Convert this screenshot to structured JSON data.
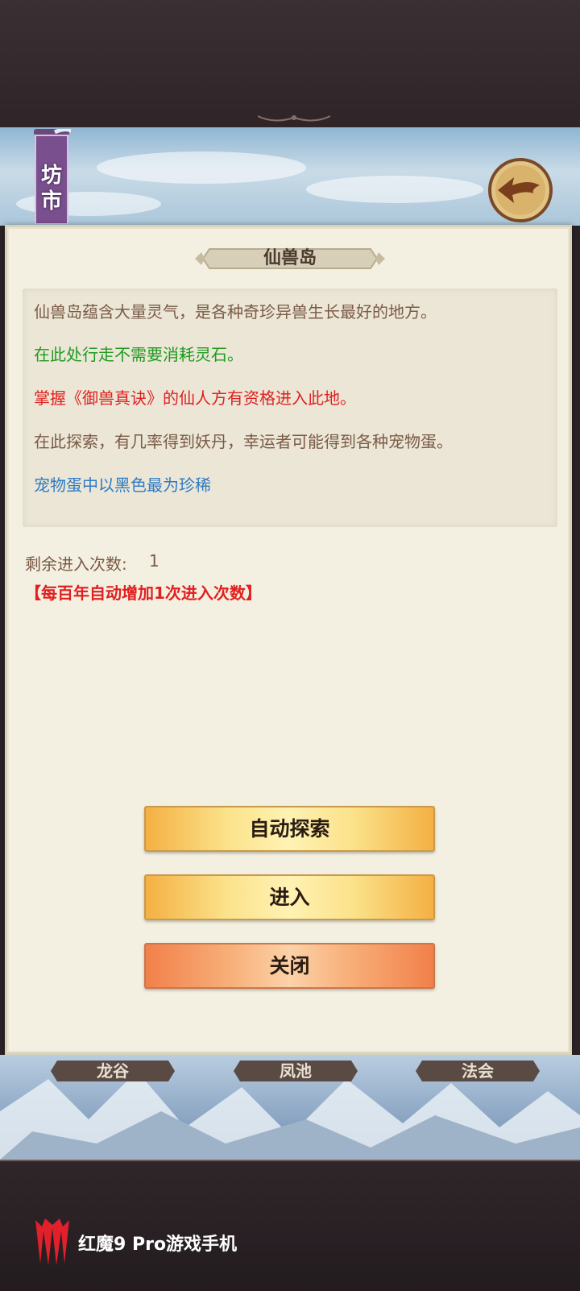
{
  "header": {
    "banner_label": "坊市",
    "back_icon": "back-arrow-icon"
  },
  "dialog": {
    "title": "仙兽岛",
    "description": [
      {
        "text": "仙兽岛蕴含大量灵气，是各种奇珍异兽生长最好的地方。",
        "color": "#7b5a46"
      },
      {
        "text": "在此处行走不需要消耗灵石。",
        "color": "#1f9a1f"
      },
      {
        "text": "掌握《御兽真诀》的仙人方有资格进入此地。",
        "color": "#e02020"
      },
      {
        "text": "在此探索，有几率得到妖丹，幸运者可能得到各种宠物蛋。",
        "color": "#7b5a46"
      },
      {
        "text": "宠物蛋中以黑色最为珍稀",
        "color": "#2e7bc4"
      }
    ],
    "remaining_label": "剩余进入次数:",
    "remaining_value": "1",
    "increase_note": "【每百年自动增加1次进入次数】",
    "buttons": {
      "auto_explore": "自动探索",
      "enter": "进入",
      "close": "关闭"
    }
  },
  "bottom_tabs": [
    "龙谷",
    "凤池",
    "法会"
  ],
  "footer": {
    "brand": "红魔9 Pro游戏手机"
  },
  "colors": {
    "panel_bg": "#f4f0e1",
    "button_yellow": "#fbe28a",
    "button_orange": "#f8b07a",
    "text_brown": "#7b5a46",
    "text_red": "#e02020",
    "text_green": "#1f9a1f",
    "text_blue": "#2e7bc4"
  }
}
